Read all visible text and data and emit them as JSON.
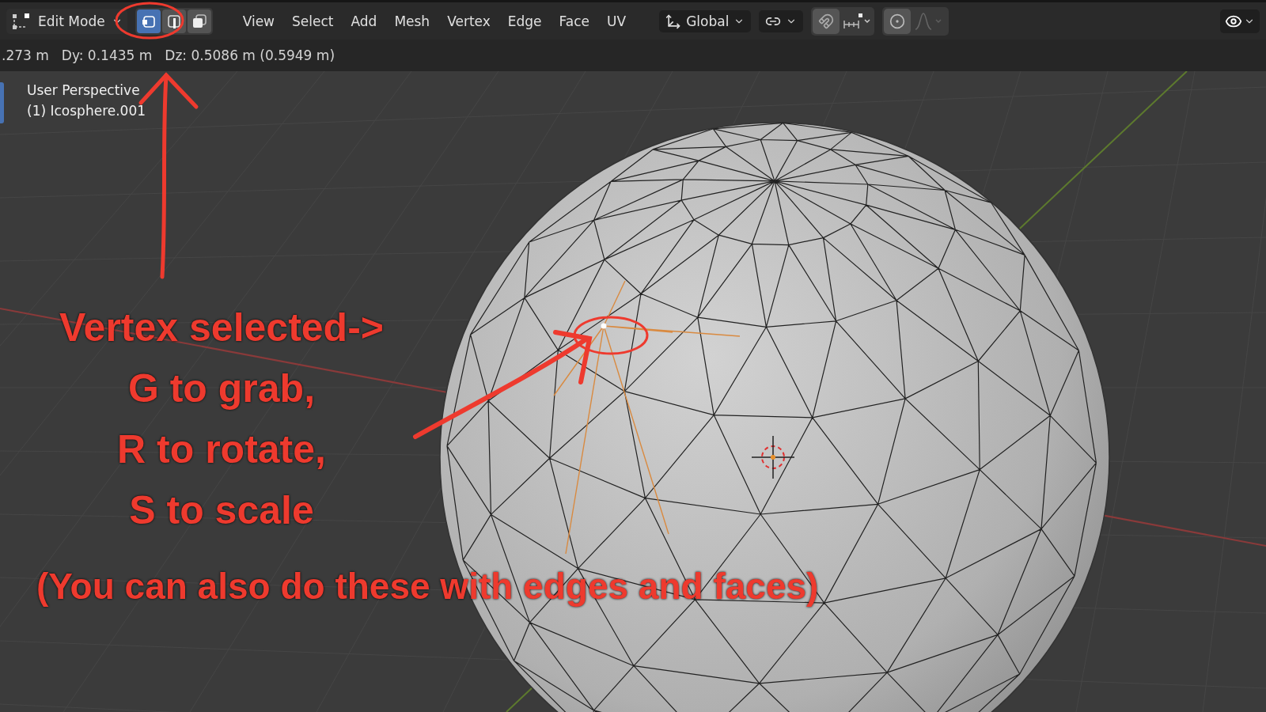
{
  "header": {
    "mode": "Edit Mode",
    "select_modes": [
      {
        "kind": "vertex",
        "selected": true
      },
      {
        "kind": "edge",
        "selected": false
      },
      {
        "kind": "face",
        "selected": false
      }
    ],
    "menus": [
      "View",
      "Select",
      "Add",
      "Mesh",
      "Vertex",
      "Edge",
      "Face",
      "UV"
    ],
    "orientation": "Global",
    "snapping": {
      "on": false
    },
    "proportional_editing": {
      "on": false
    },
    "overlays": {
      "on": true
    }
  },
  "status": [
    ".273 m",
    "Dy: 0.1435 m",
    "Dz: 0.5086 m (0.5949 m)"
  ],
  "viewport": {
    "view_name": "User Perspective",
    "object": "(1) Icosphere.001"
  },
  "annotations": {
    "lines": [
      "Vertex selected->",
      "G to grab,",
      "R to rotate,",
      "S to scale"
    ],
    "note": "(You can also do these with edges and faces)"
  }
}
